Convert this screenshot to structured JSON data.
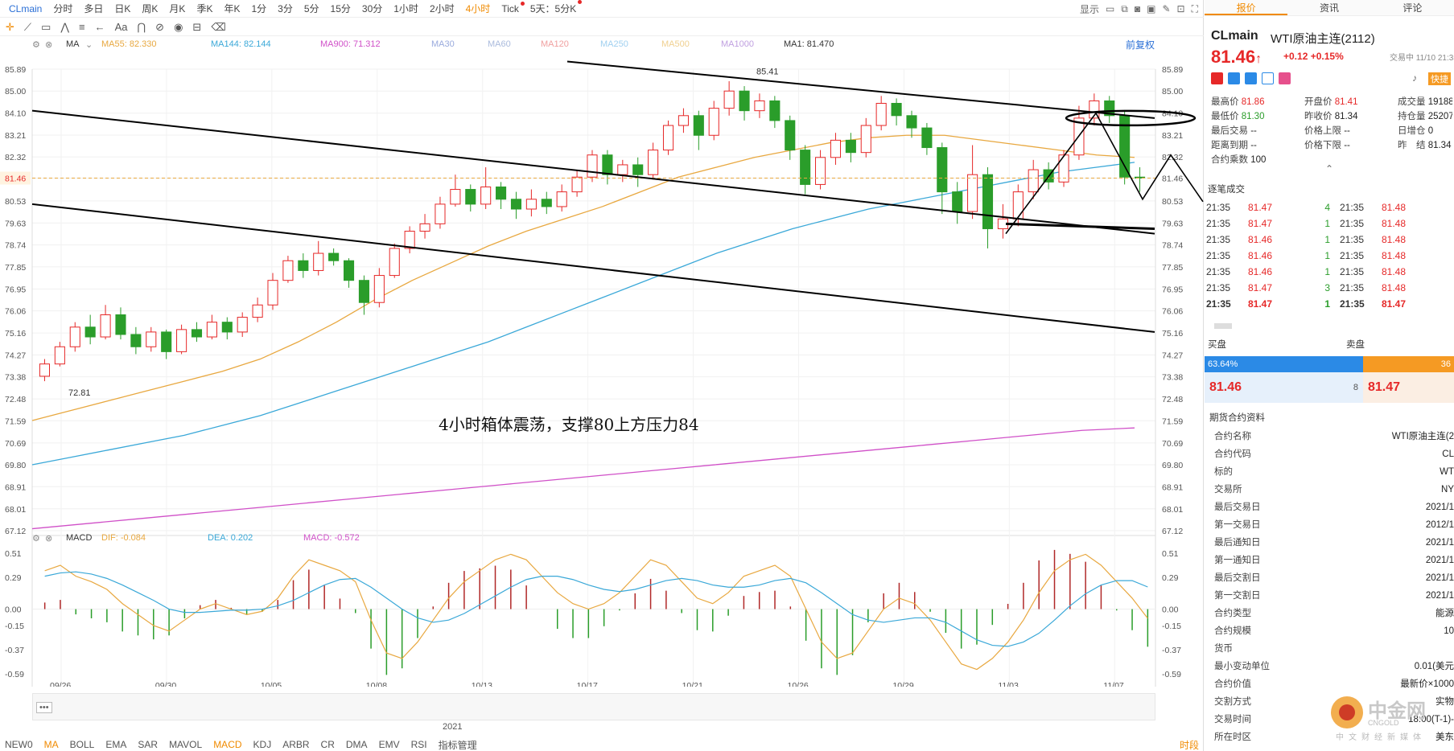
{
  "toolbar": {
    "symbol": "CLmain",
    "timeframes": [
      "分时",
      "多日",
      "日K",
      "周K",
      "月K",
      "季K",
      "年K",
      "1分",
      "3分",
      "5分",
      "15分",
      "30分",
      "1小时",
      "2小时",
      "4小时",
      "Tick",
      "5天：5分K"
    ],
    "active_timeframe": "4小时",
    "right": {
      "display": "显示"
    }
  },
  "ma_legend": {
    "ma": "MA",
    "ma55": "MA55: 82.330",
    "ma144": "MA144: 82.144",
    "ma900": "MA900: 71.312",
    "ma30": "MA30",
    "ma60": "MA60",
    "ma120": "MA120",
    "ma250": "MA250",
    "ma500": "MA500",
    "ma1000": "MA1000",
    "ma1": "MA1: 81.470",
    "fq": "前复权"
  },
  "macd_legend": {
    "name": "MACD",
    "dif": "DIF: -0.084",
    "dea": "DEA: 0.202",
    "macd": "MACD: -0.572"
  },
  "colors": {
    "up": "#e62828",
    "down": "#2a9d2a",
    "ma55": "#e8a840",
    "ma144": "#3aa8d8",
    "ma900": "#d050c8"
  },
  "chart_data": [
    {
      "type": "line",
      "kind": "candlestick",
      "ylim": [
        67.12,
        85.89
      ],
      "y_ticks": [
        "85.89",
        "85.00",
        "84.10",
        "83.21",
        "82.32",
        "81.46",
        "80.53",
        "79.63",
        "78.74",
        "77.85",
        "76.95",
        "76.06",
        "75.16",
        "74.27",
        "73.38",
        "72.48",
        "71.59",
        "70.69",
        "69.80",
        "68.91",
        "68.01",
        "67.12"
      ],
      "x_ticks": [
        "09/26",
        "09/30",
        "10/05",
        "10/08",
        "10/13",
        "10/17",
        "10/21",
        "10/26",
        "10/29",
        "11/03",
        "11/07"
      ],
      "last_price": "81.46",
      "high_label": "85.41",
      "low_label": "72.81",
      "annotation": "4小时箱体震荡，支撑80上方压力84",
      "series": [
        {
          "name": "MA55",
          "values": [
            71.6,
            72.0,
            72.4,
            72.8,
            73.2,
            73.6,
            74.1,
            74.8,
            75.6,
            76.5,
            77.3,
            78.0,
            78.7,
            79.3,
            79.8,
            80.3,
            80.9,
            81.5,
            81.9,
            82.3,
            82.6,
            82.9,
            83.1,
            83.2,
            83.2,
            83.0,
            82.8,
            82.6,
            82.4,
            82.3
          ]
        },
        {
          "name": "MA144",
          "values": [
            69.8,
            70.1,
            70.4,
            70.7,
            71.0,
            71.4,
            71.8,
            72.3,
            72.8,
            73.3,
            73.8,
            74.3,
            74.8,
            75.4,
            76.0,
            76.6,
            77.2,
            77.8,
            78.4,
            78.9,
            79.4,
            79.8,
            80.2,
            80.5,
            80.8,
            81.1,
            81.4,
            81.7,
            81.9,
            82.1
          ]
        },
        {
          "name": "MA900",
          "values": [
            67.2,
            67.4,
            67.6,
            67.8,
            68.0,
            68.2,
            68.4,
            68.6,
            68.8,
            69.0,
            69.2,
            69.4,
            69.6,
            69.8,
            70.0,
            70.2,
            70.4,
            70.6,
            70.8,
            71.0,
            71.2,
            71.3
          ]
        }
      ],
      "candles": [
        [
          73.4,
          73.9,
          73.2,
          74.1
        ],
        [
          73.9,
          74.6,
          73.8,
          74.8
        ],
        [
          74.6,
          75.4,
          74.4,
          75.6
        ],
        [
          75.4,
          75.0,
          74.7,
          75.9
        ],
        [
          75.0,
          75.9,
          74.9,
          76.3
        ],
        [
          75.9,
          75.1,
          74.9,
          76.2
        ],
        [
          75.1,
          74.6,
          74.3,
          75.4
        ],
        [
          74.6,
          75.2,
          74.4,
          75.4
        ],
        [
          75.2,
          74.4,
          74.1,
          75.3
        ],
        [
          74.4,
          75.3,
          74.3,
          75.5
        ],
        [
          75.3,
          75.0,
          74.8,
          75.6
        ],
        [
          75.0,
          75.6,
          74.9,
          75.9
        ],
        [
          75.6,
          75.2,
          74.9,
          75.8
        ],
        [
          75.2,
          75.8,
          75.0,
          76.0
        ],
        [
          75.8,
          76.3,
          75.6,
          76.6
        ],
        [
          76.3,
          77.3,
          76.1,
          77.6
        ],
        [
          77.3,
          78.1,
          77.2,
          78.3
        ],
        [
          78.1,
          77.7,
          77.4,
          78.4
        ],
        [
          77.7,
          78.4,
          77.5,
          78.9
        ],
        [
          78.4,
          78.1,
          77.9,
          78.6
        ],
        [
          78.1,
          77.3,
          77.0,
          78.2
        ],
        [
          77.3,
          76.4,
          75.9,
          77.5
        ],
        [
          76.4,
          77.5,
          76.2,
          77.8
        ],
        [
          77.5,
          78.6,
          77.4,
          78.8
        ],
        [
          78.6,
          79.3,
          78.4,
          79.5
        ],
        [
          79.3,
          79.6,
          79.0,
          80.0
        ],
        [
          79.6,
          80.4,
          79.4,
          80.7
        ],
        [
          80.4,
          81.0,
          80.3,
          81.6
        ],
        [
          81.0,
          80.4,
          80.1,
          81.2
        ],
        [
          80.4,
          81.1,
          80.2,
          81.9
        ],
        [
          81.1,
          80.6,
          80.2,
          81.3
        ],
        [
          80.6,
          80.2,
          79.8,
          80.9
        ],
        [
          80.2,
          80.6,
          79.9,
          81.0
        ],
        [
          80.6,
          80.3,
          80.0,
          80.9
        ],
        [
          80.3,
          80.9,
          80.1,
          81.2
        ],
        [
          80.9,
          81.5,
          80.7,
          81.8
        ],
        [
          81.5,
          82.4,
          81.3,
          82.6
        ],
        [
          82.4,
          81.6,
          81.2,
          82.6
        ],
        [
          81.6,
          82.0,
          81.3,
          82.2
        ],
        [
          82.0,
          81.6,
          81.1,
          82.3
        ],
        [
          81.6,
          82.6,
          81.4,
          82.9
        ],
        [
          82.6,
          83.6,
          82.4,
          83.8
        ],
        [
          83.6,
          84.0,
          83.3,
          84.3
        ],
        [
          84.0,
          83.2,
          82.6,
          84.2
        ],
        [
          83.2,
          84.3,
          83.0,
          84.6
        ],
        [
          84.3,
          85.0,
          84.0,
          85.4
        ],
        [
          85.0,
          84.2,
          83.8,
          85.2
        ],
        [
          84.2,
          84.6,
          83.9,
          84.9
        ],
        [
          84.6,
          83.8,
          83.5,
          84.8
        ],
        [
          83.8,
          82.6,
          82.2,
          84.0
        ],
        [
          82.6,
          81.2,
          80.8,
          82.8
        ],
        [
          81.2,
          82.3,
          81.0,
          82.6
        ],
        [
          82.3,
          83.0,
          82.0,
          83.3
        ],
        [
          83.0,
          82.5,
          82.1,
          83.3
        ],
        [
          82.5,
          83.6,
          82.3,
          83.9
        ],
        [
          83.6,
          84.5,
          83.4,
          84.8
        ],
        [
          84.5,
          84.0,
          83.6,
          84.7
        ],
        [
          84.0,
          83.5,
          83.1,
          84.2
        ],
        [
          83.5,
          82.7,
          82.4,
          83.7
        ],
        [
          82.7,
          80.9,
          80.0,
          82.9
        ],
        [
          80.9,
          80.1,
          79.6,
          81.3
        ],
        [
          80.1,
          81.6,
          79.8,
          82.8
        ],
        [
          81.6,
          79.4,
          78.6,
          81.9
        ],
        [
          79.4,
          79.8,
          79.0,
          80.4
        ],
        [
          79.8,
          80.9,
          79.5,
          81.2
        ],
        [
          80.9,
          81.8,
          80.6,
          82.2
        ],
        [
          81.8,
          81.3,
          81.0,
          82.1
        ],
        [
          81.3,
          82.4,
          81.1,
          82.6
        ],
        [
          82.4,
          83.9,
          82.2,
          84.4
        ],
        [
          83.9,
          84.6,
          83.6,
          84.9
        ],
        [
          84.6,
          84.0,
          83.7,
          84.8
        ],
        [
          84.0,
          81.5,
          81.2,
          84.2
        ],
        [
          81.5,
          81.46,
          80.9,
          81.9
        ]
      ]
    },
    {
      "type": "bar",
      "kind": "macd",
      "ylim": [
        -0.59,
        0.51
      ],
      "y_ticks": [
        "0.51",
        "0.29",
        "0.00",
        "-0.15",
        "-0.37",
        "-0.59"
      ],
      "dif": [
        0.35,
        0.4,
        0.3,
        0.25,
        0.18,
        0.05,
        -0.05,
        -0.15,
        -0.2,
        -0.1,
        0.0,
        0.05,
        0.0,
        -0.05,
        -0.02,
        0.1,
        0.3,
        0.45,
        0.4,
        0.35,
        0.25,
        -0.1,
        -0.4,
        -0.45,
        -0.3,
        -0.1,
        0.1,
        0.25,
        0.35,
        0.45,
        0.5,
        0.45,
        0.3,
        0.15,
        0.05,
        0.0,
        0.05,
        0.15,
        0.3,
        0.45,
        0.4,
        0.25,
        0.1,
        0.05,
        0.15,
        0.3,
        0.35,
        0.4,
        0.3,
        0.0,
        -0.3,
        -0.45,
        -0.4,
        -0.2,
        0.0,
        0.1,
        0.05,
        -0.1,
        -0.3,
        -0.5,
        -0.55,
        -0.45,
        -0.3,
        -0.1,
        0.15,
        0.35,
        0.45,
        0.5,
        0.4,
        0.25,
        0.1,
        -0.084
      ],
      "dea": [
        0.3,
        0.33,
        0.34,
        0.32,
        0.28,
        0.22,
        0.15,
        0.08,
        0.0,
        -0.03,
        -0.03,
        -0.02,
        -0.01,
        -0.01,
        0.0,
        0.03,
        0.08,
        0.15,
        0.22,
        0.27,
        0.28,
        0.2,
        0.1,
        0.0,
        -0.08,
        -0.12,
        -0.1,
        -0.04,
        0.04,
        0.12,
        0.2,
        0.27,
        0.3,
        0.3,
        0.27,
        0.22,
        0.18,
        0.16,
        0.18,
        0.22,
        0.26,
        0.28,
        0.26,
        0.22,
        0.2,
        0.2,
        0.22,
        0.26,
        0.28,
        0.24,
        0.15,
        0.05,
        -0.05,
        -0.1,
        -0.12,
        -0.1,
        -0.08,
        -0.08,
        -0.12,
        -0.2,
        -0.28,
        -0.33,
        -0.34,
        -0.3,
        -0.22,
        -0.1,
        0.03,
        0.14,
        0.22,
        0.26,
        0.26,
        0.202
      ],
      "macd": [
        0.1,
        0.14,
        -0.08,
        -0.14,
        -0.2,
        -0.34,
        -0.4,
        -0.46,
        -0.4,
        -0.14,
        0.06,
        0.14,
        0.02,
        -0.08,
        -0.04,
        0.14,
        0.44,
        0.6,
        0.36,
        0.16,
        -0.06,
        -0.6,
        -1.0,
        -0.9,
        -0.44,
        0.04,
        0.4,
        0.58,
        0.62,
        0.66,
        0.6,
        0.36,
        0.0,
        -0.3,
        -0.44,
        -0.44,
        -0.26,
        -0.02,
        0.24,
        0.46,
        0.28,
        -0.06,
        -0.32,
        -0.34,
        -0.1,
        0.2,
        0.26,
        0.28,
        0.04,
        -0.48,
        -0.9,
        -1.0,
        -0.7,
        -0.2,
        0.24,
        0.4,
        0.26,
        -0.04,
        -0.36,
        -0.6,
        -0.54,
        -0.24,
        0.08,
        0.4,
        0.74,
        0.9,
        0.84,
        0.72,
        0.36,
        -0.02,
        -0.32,
        -0.572
      ]
    }
  ],
  "scroll_year": "2021",
  "bottom_tabs": [
    "NEW0",
    "MA",
    "BOLL",
    "EMA",
    "SAR",
    "MAVOL",
    "MACD",
    "KDJ",
    "ARBR",
    "CR",
    "DMA",
    "EMV",
    "RSI",
    "指标管理"
  ],
  "bottom_active": [
    "MA",
    "MACD"
  ],
  "right_tail": "时段",
  "panel": {
    "tabs": [
      "报价",
      "资讯",
      "评论"
    ],
    "symbol": "CLmain",
    "name": "WTI原油主连(2112)",
    "price": "81.46",
    "arrow": "↑",
    "change": "+0.12",
    "change_pct": "+0.15%",
    "trade_status": "交易中 11/10 21:35",
    "fast": "快捷",
    "stats": [
      [
        {
          "k": "最高价",
          "v": "81.86",
          "c": "up"
        },
        {
          "k": "开盘价",
          "v": "81.41",
          "c": "up"
        },
        {
          "k": "成交量",
          "v": "19188",
          "c": ""
        }
      ],
      [
        {
          "k": "最低价",
          "v": "81.30",
          "c": "dn"
        },
        {
          "k": "昨收价",
          "v": "81.34",
          "c": ""
        },
        {
          "k": "持仓量",
          "v": "25207",
          "c": ""
        }
      ],
      [
        {
          "k": "最后交易",
          "v": "--",
          "c": ""
        },
        {
          "k": "价格上限",
          "v": "--",
          "c": ""
        },
        {
          "k": "日增仓",
          "v": "0",
          "c": ""
        }
      ],
      [
        {
          "k": "距离到期",
          "v": "--",
          "c": ""
        },
        {
          "k": "价格下限",
          "v": "--",
          "c": ""
        },
        {
          "k": "昨　结",
          "v": "81.34",
          "c": ""
        }
      ],
      [
        {
          "k": "合约乘数",
          "v": "1000",
          "c": ""
        }
      ]
    ],
    "trades_title": "逐笔成交",
    "trades": [
      [
        "21:35",
        "81.47",
        "4",
        "21:35",
        "81.48"
      ],
      [
        "21:35",
        "81.47",
        "1",
        "21:35",
        "81.48"
      ],
      [
        "21:35",
        "81.46",
        "1",
        "21:35",
        "81.48"
      ],
      [
        "21:35",
        "81.46",
        "1",
        "21:35",
        "81.48"
      ],
      [
        "21:35",
        "81.46",
        "1",
        "21:35",
        "81.48"
      ],
      [
        "21:35",
        "81.47",
        "3",
        "21:35",
        "81.48"
      ],
      [
        "21:35",
        "81.47",
        "1",
        "21:35",
        "81.47"
      ]
    ],
    "bid_label": "买盘",
    "ask_label": "卖盘",
    "bid_pct": "63.64%",
    "ask_pct": "36",
    "bid_fraction": 0.6364,
    "bid_price": "81.46",
    "bid_qty": "8",
    "ask_price": "81.47",
    "contract_title": "期货合约资料",
    "contract": [
      [
        "合约名称",
        "WTI原油主连(2"
      ],
      [
        "合约代码",
        "CL"
      ],
      [
        "标的",
        "WT"
      ],
      [
        "交易所",
        "NY"
      ],
      [
        "最后交易日",
        "2021/1"
      ],
      [
        "第一交易日",
        "2012/1"
      ],
      [
        "最后通知日",
        "2021/1"
      ],
      [
        "第一通知日",
        "2021/1"
      ],
      [
        "最后交割日",
        "2021/1"
      ],
      [
        "第一交割日",
        "2021/1"
      ],
      [
        "合约类型",
        "能源"
      ],
      [
        "合约规模",
        "10"
      ],
      [
        "货币",
        ""
      ],
      [
        "最小变动单位",
        "0.01(美元"
      ],
      [
        "合约价值",
        "最新价×1000"
      ],
      [
        "交割方式",
        "实物"
      ],
      [
        "交易时间",
        "18:00(T-1)-"
      ],
      [
        "所在时区",
        "美东"
      ]
    ]
  },
  "watermark": {
    "title": "中金网",
    "sub": "CNGOLD",
    "tag": "中文财经新媒体"
  }
}
